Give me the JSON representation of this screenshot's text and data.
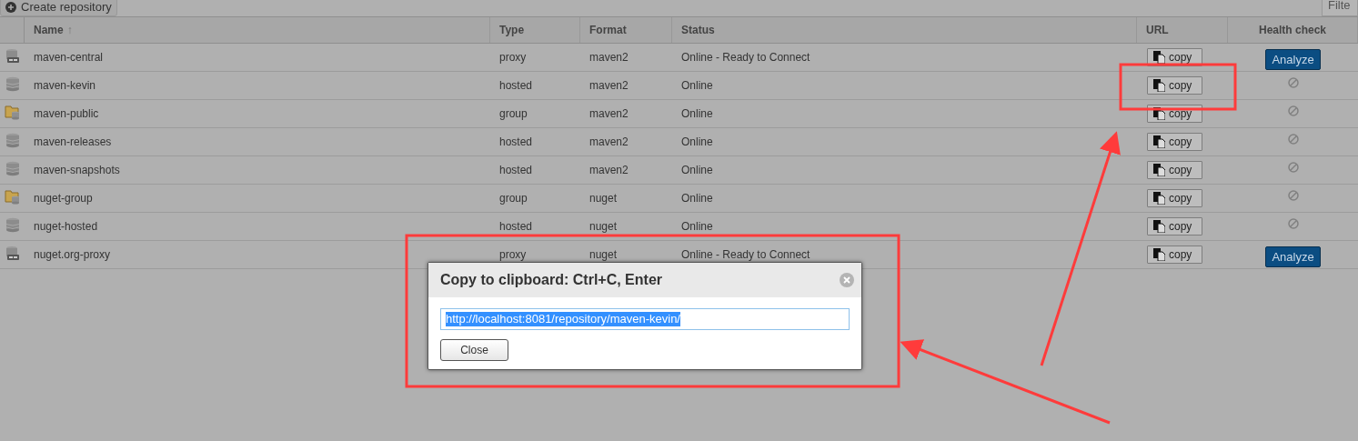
{
  "toolbar": {
    "create_button": "Create repository",
    "filter": {
      "placeholder": "Filte"
    }
  },
  "table": {
    "columns": [
      "Name",
      "Type",
      "Format",
      "Status",
      "URL",
      "Health check"
    ],
    "sort_mark": "↑",
    "rows": [
      {
        "kind": "proxy",
        "name": "maven-central",
        "type": "proxy",
        "format": "maven2",
        "status": "Online - Ready to Connect",
        "url_button": "copy",
        "health": {
          "kind": "button",
          "label": "Analyze"
        }
      },
      {
        "kind": "hosted",
        "name": "maven-kevin",
        "type": "hosted",
        "format": "maven2",
        "status": "Online",
        "url_button": "copy",
        "health": {
          "kind": "unavailable"
        }
      },
      {
        "kind": "group",
        "name": "maven-public",
        "type": "group",
        "format": "maven2",
        "status": "Online",
        "url_button": "copy",
        "health": {
          "kind": "unavailable"
        }
      },
      {
        "kind": "hosted",
        "name": "maven-releases",
        "type": "hosted",
        "format": "maven2",
        "status": "Online",
        "url_button": "copy",
        "health": {
          "kind": "unavailable"
        }
      },
      {
        "kind": "hosted",
        "name": "maven-snapshots",
        "type": "hosted",
        "format": "maven2",
        "status": "Online",
        "url_button": "copy",
        "health": {
          "kind": "unavailable"
        }
      },
      {
        "kind": "group",
        "name": "nuget-group",
        "type": "group",
        "format": "nuget",
        "status": "Online",
        "url_button": "copy",
        "health": {
          "kind": "unavailable"
        }
      },
      {
        "kind": "hosted",
        "name": "nuget-hosted",
        "type": "hosted",
        "format": "nuget",
        "status": "Online",
        "url_button": "copy",
        "health": {
          "kind": "unavailable"
        }
      },
      {
        "kind": "proxy",
        "name": "nuget.org-proxy",
        "type": "proxy",
        "format": "nuget",
        "status": "Online - Ready to Connect",
        "url_button": "copy",
        "health": {
          "kind": "button",
          "label": "Analyze"
        }
      }
    ]
  },
  "dialog": {
    "title": "Copy to clipboard: Ctrl+C, Enter",
    "value": "http://localhost:8081/repository/maven-kevin/",
    "close_button": "Close"
  }
}
